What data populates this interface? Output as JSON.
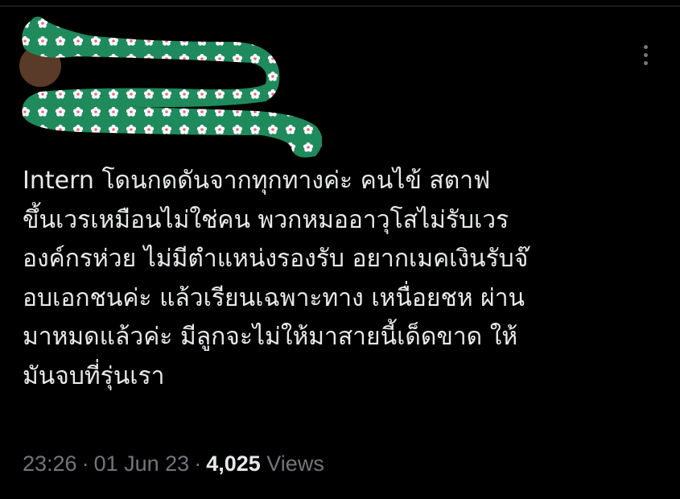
{
  "tweet": {
    "lines": [
      "Intern โดนกดดันจากทุกทางค่ะ คนไข้ สตาฟ",
      "ขึ้นเวรเหมือนไม่ใช่คน พวกหมออาวุโสไม่รับเวร",
      "องค์กรห่วย ไม่มีตำแหน่งรองรับ อยากเมคเงินรับจ๊",
      "อบเอกชนค่ะ แล้วเรียนเฉพาะทาง เหนื่อยชห ผ่าน",
      "มาหมดแล้วค่ะ มีลูกจะไม่ให้มาสายนี้เด็ดขาด ให้",
      "มันจบที่รุ่นเรา"
    ],
    "time": "23:26",
    "separator": "·",
    "date": "01 Jun 23",
    "views_count": "4,025",
    "views_label": "Views"
  },
  "icons": {
    "more": "more-vertical-icon"
  },
  "colors": {
    "background": "#000000",
    "text": "#e7e9ea",
    "muted": "#71767b",
    "redaction_green": "#1f8a5c"
  }
}
